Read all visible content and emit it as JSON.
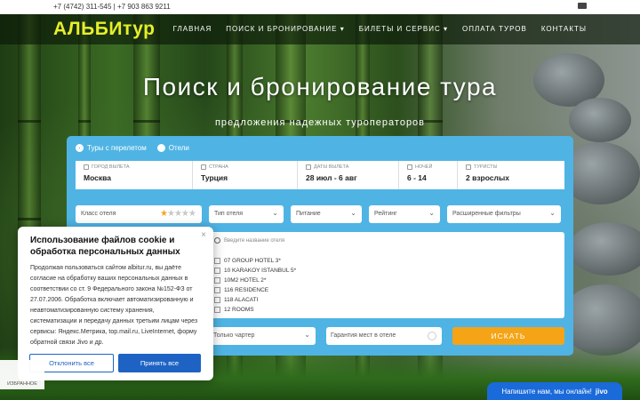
{
  "topbar": {
    "phones": "+7 (4742) 311-545 | +7 903 863 9211"
  },
  "header": {
    "logo": "АЛЬБИтур",
    "nav": [
      "ГЛАВНАЯ",
      "ПОИСК И БРОНИРОВАНИЕ",
      "БИЛЕТЫ И СЕРВИС",
      "ОПЛАТА ТУРОВ",
      "КОНТАКТЫ"
    ]
  },
  "hero": {
    "title": "Поиск и бронирование тура",
    "subtitle": "предложения надежных туроператоров"
  },
  "search": {
    "modes": [
      "Туры с перелетом",
      "Отели"
    ],
    "selected_mode": "Туры с перелетом",
    "fields": [
      {
        "label": "ГОРОД ВЫЛЕТА",
        "value": "Москва"
      },
      {
        "label": "СТРАНА",
        "value": "Турция"
      },
      {
        "label": "ДАТЫ ВЫЛЕТА",
        "value": "28 июл - 6 авг"
      },
      {
        "label": "НОЧЕЙ",
        "value": "6 - 14"
      },
      {
        "label": "ТУРИСТЫ",
        "value": "2 взрослых"
      }
    ],
    "hotel_class_label": "Класс отеля",
    "hotel_class_stars": 1,
    "hotel_class_max": 5,
    "hotel_type": "Тип отеля",
    "meal": "Питание",
    "rating": "Рейтинг",
    "advanced": "Расширенные фильтры",
    "hotel_search_placeholder": "Введите название отеля",
    "hotels": [
      "07 GROUP HOTEL 3*",
      "10 KARAKOY ISTANBUL 5*",
      "10M2 HOTEL 2*",
      "116 RESIDENCE",
      "118 ALACATI",
      "12 ROOMS"
    ],
    "charter": "Только чартер",
    "guarantee": "Гарантия мест в отеле",
    "submit": "ИСКАТЬ"
  },
  "cookie": {
    "title": "Использование файлов cookie и обработка персональных данных",
    "body": "Продолжая пользоваться сайтом albitur.ru, вы даёте согласие на обработку ваших персональных данных в соответствии со ст. 9 Федерального закона №152-ФЗ от 27.07.2006. Обработка включает автоматизированную и неавтоматизированную систему хранения, систематизации и передачу данных третьим лицам через сервисы: Яндекс.Метрика, top.mail.ru, LiveInternet, форму обратной связи Jivo и др.",
    "reject": "Отклонить все",
    "accept": "Принять все"
  },
  "favorites": "ИЗБРАННОЕ",
  "chat": {
    "text": "Напишите нам, мы онлайн!",
    "brand": "jivo"
  },
  "colors": {
    "logo": "#e6ef2a",
    "panel": "#4fb4e4",
    "accent": "#f5a417",
    "primary_blue": "#1e63c4"
  }
}
